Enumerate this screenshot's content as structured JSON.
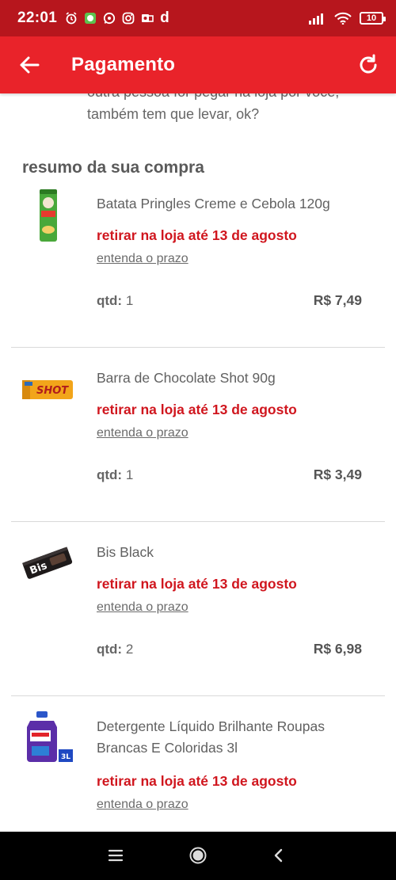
{
  "status_bar": {
    "time": "22:01",
    "carrier_letter": "d",
    "battery": "10"
  },
  "header": {
    "title": "Pagamento"
  },
  "notice": {
    "text": "outra pessoa for pegar na loja por você, também tem que levar, ok?"
  },
  "summary": {
    "title": "resumo da sua compra"
  },
  "items": [
    {
      "name": "Batata Pringles Creme e Cebola 120g",
      "deadline": "retirar na loja até 13 de agosto",
      "link": "entenda o prazo",
      "qty_label": "qtd:",
      "qty": "1",
      "price": "R$ 7,49",
      "image": "pringles-can"
    },
    {
      "name": "Barra de Chocolate Shot 90g",
      "deadline": "retirar na loja até 13 de agosto",
      "link": "entenda o prazo",
      "qty_label": "qtd:",
      "qty": "1",
      "price": "R$ 3,49",
      "image": "shot-chocolate-bar"
    },
    {
      "name": "Bis Black",
      "deadline": "retirar na loja até 13 de agosto",
      "link": "entenda o prazo",
      "qty_label": "qtd:",
      "qty": "2",
      "price": "R$ 6,98",
      "image": "bis-black-pack"
    },
    {
      "name": "Detergente Líquido Brilhante Roupas Brancas E Coloridas 3l",
      "deadline": "retirar na loja até 13 de agosto",
      "link": "entenda o prazo",
      "image": "detergent-bottle",
      "badge": "3L"
    }
  ],
  "colors": {
    "status_bar": "#b7161d",
    "app_bar": "#e9232a",
    "deadline": "#d0161e",
    "nav_bar": "#000000"
  }
}
